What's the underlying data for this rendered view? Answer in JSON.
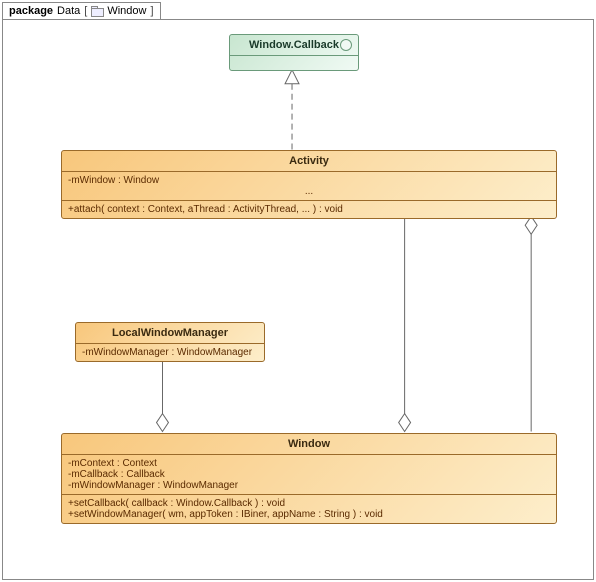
{
  "package": {
    "keyword": "package",
    "name": "Data",
    "bracket_open": "[",
    "bracket_close": "]",
    "subject": "Window"
  },
  "classes": {
    "window_callback": {
      "name": "Window.Callback"
    },
    "activity": {
      "name": "Activity",
      "attrs": [
        "-mWindow : Window"
      ],
      "ellipsis": "...",
      "ops": [
        "+attach( context : Context, aThread : ActivityThread, ... ) : void"
      ]
    },
    "local_window_manager": {
      "name": "LocalWindowManager",
      "attrs": [
        "-mWindowManager : WindowManager"
      ]
    },
    "window": {
      "name": "Window",
      "attrs": [
        "-mContext : Context",
        "-mCallback : Callback",
        "-mWindowManager : WindowManager"
      ],
      "ops": [
        "+setCallback( callback : Window.Callback ) : void",
        "+setWindowManager( wm, appToken : IBiner, appName : String ) : void"
      ]
    }
  }
}
